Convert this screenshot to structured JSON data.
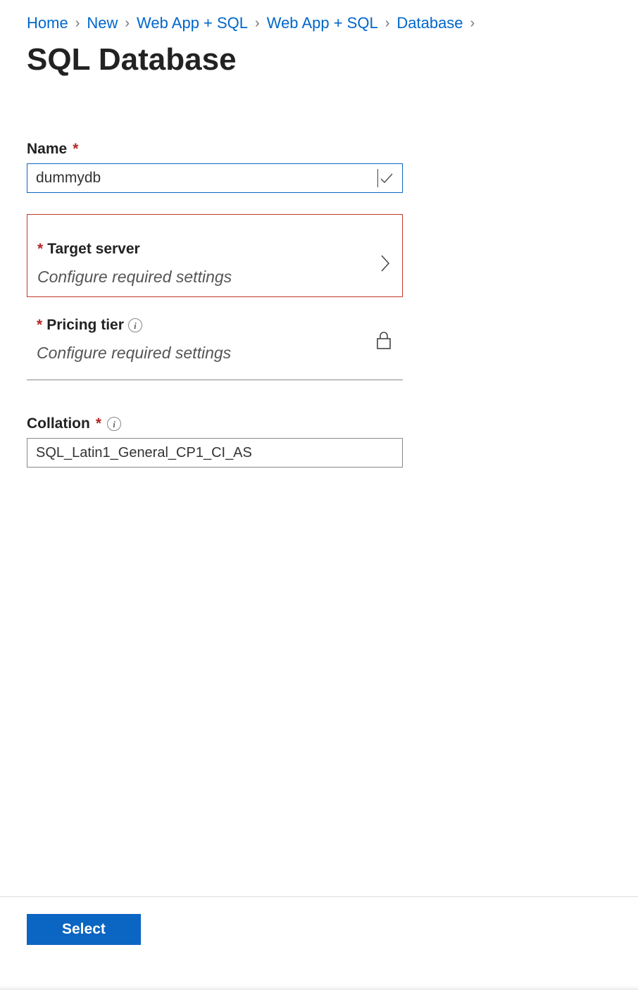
{
  "breadcrumb": {
    "items": [
      "Home",
      "New",
      "Web App + SQL",
      "Web App + SQL",
      "Database"
    ]
  },
  "title": "SQL Database",
  "fields": {
    "name": {
      "label": "Name",
      "value": "dummydb"
    },
    "target_server": {
      "label": "Target server",
      "placeholder": "Configure required settings"
    },
    "pricing_tier": {
      "label": "Pricing tier",
      "placeholder": "Configure required settings"
    },
    "collation": {
      "label": "Collation",
      "value": "SQL_Latin1_General_CP1_CI_AS"
    }
  },
  "footer": {
    "select_label": "Select"
  }
}
